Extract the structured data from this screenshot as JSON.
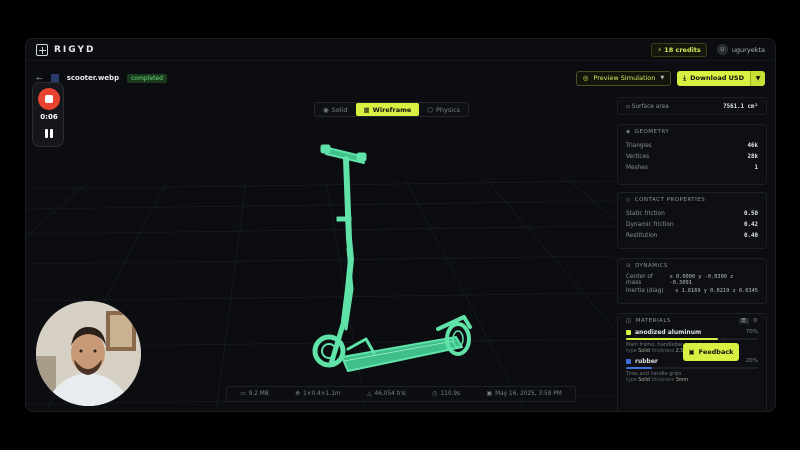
{
  "app": {
    "name": "RIGYD"
  },
  "header": {
    "credits": "18 credits",
    "avatar_initial": "U",
    "username": "uguryekta"
  },
  "file": {
    "name": "scooter.webp",
    "status": "completed"
  },
  "actions": {
    "preview": "Preview Simulation",
    "download": "Download USD"
  },
  "view_tabs": [
    {
      "label": "Solid",
      "active": false
    },
    {
      "label": "Wireframe",
      "active": true
    },
    {
      "label": "Physics",
      "active": false
    }
  ],
  "bottom_bar": {
    "size": "9.2 MB",
    "dimensions": "1×0.4×1.1m",
    "tris": "46,054 tris",
    "time": "110.9s",
    "date": "May 16, 2025, 3:58 PM"
  },
  "surface": {
    "label": "Surface area",
    "value": "7561.1 cm²"
  },
  "geometry": {
    "title": "GEOMETRY",
    "rows": [
      {
        "label": "Triangles",
        "value": "46k"
      },
      {
        "label": "Vertices",
        "value": "28k"
      },
      {
        "label": "Meshes",
        "value": "1"
      }
    ]
  },
  "contact": {
    "title": "CONTACT PROPERTIES",
    "rows": [
      {
        "label": "Static friction",
        "value": "0.50"
      },
      {
        "label": "Dynamic friction",
        "value": "0.42"
      },
      {
        "label": "Restitution",
        "value": "0.40"
      }
    ]
  },
  "dynamics": {
    "title": "DYNAMICS",
    "center_label": "Center of mass",
    "center_value": "x 0.0000  y -0.0300  z -0.3091",
    "inertia_label": "Inertia (diag)",
    "inertia_value": "x 1.6169  y 0.0219  z 0.0345"
  },
  "materials": {
    "title": "MATERIALS",
    "items": [
      {
        "name": "anodized aluminum",
        "pct": "70%",
        "fill": 0.7,
        "color": "#d8f041",
        "desc": "Main frame, handlebar, and deck structure",
        "type": "Solid",
        "thickness": "2.5mm",
        "cost": "high"
      },
      {
        "name": "rubber",
        "pct": "20%",
        "fill": 0.2,
        "color": "#3f6fe0",
        "desc": "Tires and handle grips",
        "type": "Solid",
        "thickness": "3mm",
        "cost": ""
      }
    ],
    "type_label": "type",
    "thickness_label": "thickness",
    "cost_label": "cost"
  },
  "feedback": "Feedback",
  "recorder": {
    "time": "0:06"
  },
  "colors": {
    "accent": "#d8f041",
    "wire": "#5fe3a8"
  }
}
